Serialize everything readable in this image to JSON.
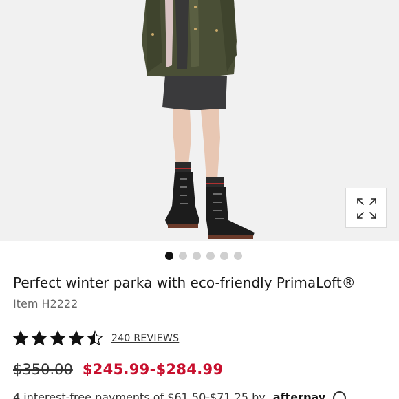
{
  "product": {
    "title": "Perfect winter parka with eco-friendly PrimaLoft®",
    "item_number": "Item H2222",
    "rating": 4.5,
    "rating_max": 5,
    "reviews_label": "240 REVIEWS",
    "original_price": "$350.00",
    "sale_price": "$245.99-$284.99",
    "installments_text": "4 interest-free payments of $61.50-$71.25 by",
    "installments_brand": "afterpay",
    "sale_color": "#c8102e"
  },
  "carousel": {
    "total_slides": 6,
    "active_index": 0
  },
  "icons": {
    "expand": "expand-icon",
    "star": "star-icon",
    "info": "info-icon"
  }
}
